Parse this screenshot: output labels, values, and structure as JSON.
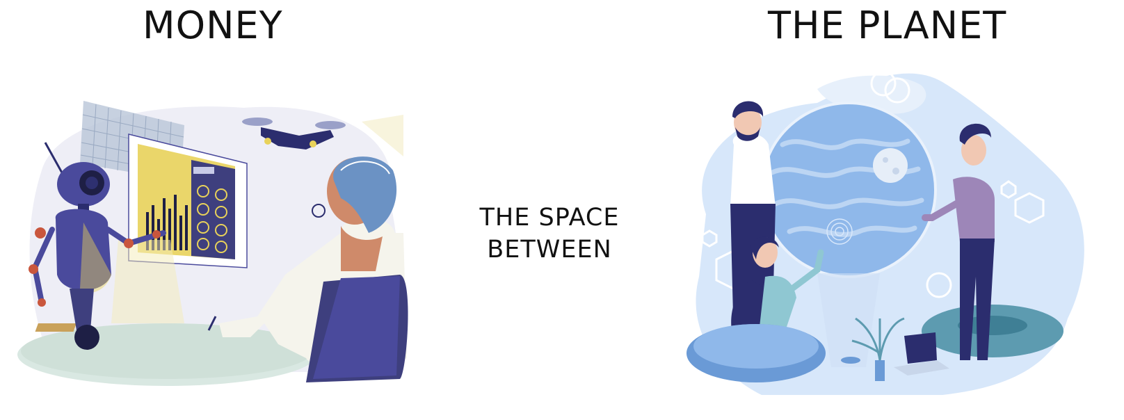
{
  "headings": {
    "left": "MONEY",
    "right": "THE PLANET"
  },
  "center": {
    "line1": "THE SPACE",
    "line2": "BETWEEN"
  },
  "colors": {
    "navy": "#2b2d6e",
    "purple": "#4a4a9c",
    "yellow": "#e8d25a",
    "sky": "#8fb8ea",
    "light_blue": "#d7e7fa",
    "accent_red": "#c9563d",
    "table": "#cfe0d8"
  },
  "illustrations": {
    "left": "robot-and-analyst-icon",
    "right": "people-around-planet-icon"
  }
}
